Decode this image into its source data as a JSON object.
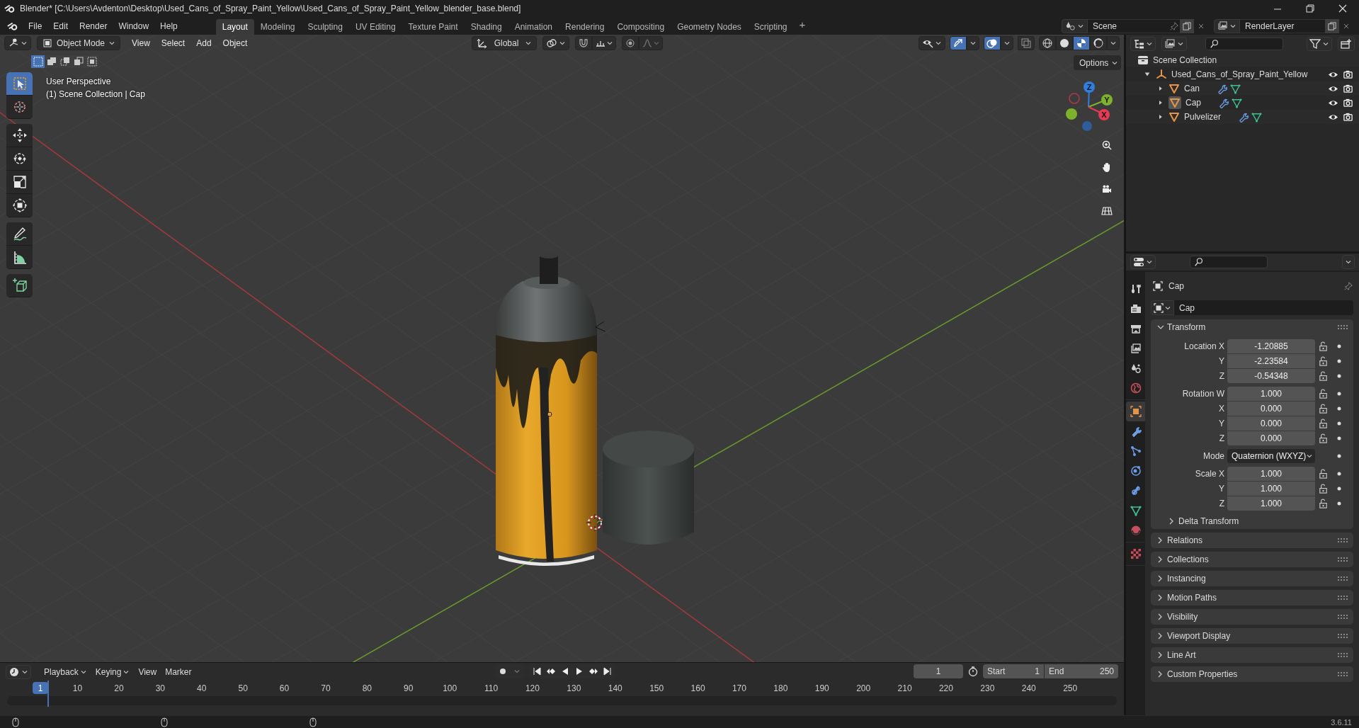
{
  "window": {
    "title": "Blender* [C:\\Users\\Avdenton\\Desktop\\Used_Cans_of_Spray_Paint_Yellow\\Used_Cans_of_Spray_Paint_Yellow_blender_base.blend]"
  },
  "menu": [
    "File",
    "Edit",
    "Render",
    "Window",
    "Help"
  ],
  "workspaces": [
    {
      "label": "Layout",
      "selected": true
    },
    {
      "label": "Modeling",
      "selected": false
    },
    {
      "label": "Sculpting",
      "selected": false
    },
    {
      "label": "UV Editing",
      "selected": false
    },
    {
      "label": "Texture Paint",
      "selected": false
    },
    {
      "label": "Shading",
      "selected": false
    },
    {
      "label": "Animation",
      "selected": false
    },
    {
      "label": "Rendering",
      "selected": false
    },
    {
      "label": "Compositing",
      "selected": false
    },
    {
      "label": "Geometry Nodes",
      "selected": false
    },
    {
      "label": "Scripting",
      "selected": false
    }
  ],
  "add_workspace": "+",
  "scene": "Scene",
  "view_layer": "RenderLayer",
  "viewport": {
    "mode": "Object Mode",
    "menus": [
      "View",
      "Select",
      "Add",
      "Object"
    ],
    "orientation": "Global",
    "toggles": [
      {
        "kind": "gizmos",
        "on": true
      },
      {
        "kind": "overlays",
        "on": true
      },
      {
        "kind": "xray",
        "on": false
      }
    ],
    "shading": [
      {
        "kind": "wireframe",
        "selected": false
      },
      {
        "kind": "solid",
        "selected": false
      },
      {
        "kind": "material",
        "selected": true
      },
      {
        "kind": "rendered",
        "selected": false
      }
    ],
    "select_modes": [
      {
        "kind": "set",
        "selected": true
      },
      {
        "kind": "extend",
        "selected": false
      },
      {
        "kind": "subtract",
        "selected": false
      },
      {
        "kind": "invert",
        "selected": false
      },
      {
        "kind": "intersect",
        "selected": false
      }
    ],
    "options": "Options",
    "overlay_text": [
      "User Perspective",
      "(1) Scene Collection | Cap"
    ],
    "tools": [
      [
        {
          "kind": "select",
          "selected": true
        },
        {
          "kind": "cursor",
          "selected": false
        }
      ],
      [
        {
          "kind": "move",
          "selected": false
        },
        {
          "kind": "rotate",
          "selected": false
        },
        {
          "kind": "scale",
          "selected": false
        },
        {
          "kind": "transform",
          "selected": false
        }
      ],
      [
        {
          "kind": "annotate",
          "selected": false
        },
        {
          "kind": "measure",
          "selected": false
        }
      ],
      [
        {
          "kind": "add_cube",
          "selected": false
        }
      ]
    ],
    "axes": [
      "Z",
      "Y",
      "X"
    ]
  },
  "outliner": {
    "root": "Scene Collection",
    "items": [
      {
        "label": "Used_Cans_of_Spray_Paint_Yellow",
        "kind": "empty",
        "expanded": true,
        "active": false,
        "children": [
          {
            "label": "Can",
            "kind": "mesh",
            "expanded": false,
            "active": false
          },
          {
            "label": "Cap",
            "kind": "mesh",
            "expanded": false,
            "active": true
          },
          {
            "label": "Pulvelizer",
            "kind": "mesh",
            "expanded": false,
            "active": false
          }
        ]
      }
    ]
  },
  "properties": {
    "tabs": [
      [
        {
          "kind": "tool",
          "selected": false
        },
        {
          "kind": "render",
          "selected": false
        },
        {
          "kind": "output",
          "selected": false
        },
        {
          "kind": "view_layer",
          "selected": false
        },
        {
          "kind": "scene",
          "selected": false
        },
        {
          "kind": "world",
          "selected": false
        }
      ],
      [
        {
          "kind": "object",
          "selected": true
        },
        {
          "kind": "modifiers",
          "selected": false
        },
        {
          "kind": "particles",
          "selected": false
        },
        {
          "kind": "physics",
          "selected": false
        },
        {
          "kind": "constraints",
          "selected": false
        },
        {
          "kind": "data",
          "selected": false
        },
        {
          "kind": "material",
          "selected": false
        }
      ],
      [
        {
          "kind": "texture",
          "selected": false
        }
      ]
    ],
    "object": "Cap",
    "data_name": "Cap",
    "transform": {
      "title": "Transform",
      "expanded": true,
      "groups": [
        [
          {
            "label": "Location X",
            "value": "-1.20885",
            "kind": "number"
          },
          {
            "label": "Y",
            "value": "-2.23584",
            "kind": "number"
          },
          {
            "label": "Z",
            "value": "-0.54348",
            "kind": "number"
          }
        ],
        [
          {
            "label": "Rotation W",
            "value": "1.000",
            "kind": "number"
          },
          {
            "label": "X",
            "value": "0.000",
            "kind": "number"
          },
          {
            "label": "Y",
            "value": "0.000",
            "kind": "number"
          },
          {
            "label": "Z",
            "value": "0.000",
            "kind": "number"
          }
        ],
        [
          {
            "label": "Mode",
            "value": "Quaternion (WXYZ)",
            "kind": "dropdown"
          }
        ],
        [
          {
            "label": "Scale X",
            "value": "1.000",
            "kind": "number"
          },
          {
            "label": "Y",
            "value": "1.000",
            "kind": "number"
          },
          {
            "label": "Z",
            "value": "1.000",
            "kind": "number"
          }
        ]
      ],
      "subpanels": [
        {
          "title": "Delta Transform",
          "expanded": false
        }
      ]
    },
    "panels": [
      {
        "title": "Relations",
        "expanded": false
      },
      {
        "title": "Collections",
        "expanded": false
      },
      {
        "title": "Instancing",
        "expanded": false
      },
      {
        "title": "Motion Paths",
        "expanded": false
      },
      {
        "title": "Visibility",
        "expanded": false
      },
      {
        "title": "Viewport Display",
        "expanded": false
      },
      {
        "title": "Line Art",
        "expanded": false
      },
      {
        "title": "Custom Properties",
        "expanded": false
      }
    ]
  },
  "timeline": {
    "menus": [
      "Playback",
      "Keying",
      "View",
      "Marker"
    ],
    "current_frame": "1",
    "start_label": "Start",
    "start": "1",
    "end_label": "End",
    "end": "250",
    "playhead": "1",
    "ticks": [
      "10",
      "20",
      "30",
      "40",
      "50",
      "60",
      "70",
      "80",
      "90",
      "100",
      "110",
      "120",
      "130",
      "140",
      "150",
      "160",
      "170",
      "180",
      "190",
      "200",
      "210",
      "220",
      "230",
      "240",
      "250"
    ]
  },
  "status": {
    "version": "3.6.11"
  }
}
